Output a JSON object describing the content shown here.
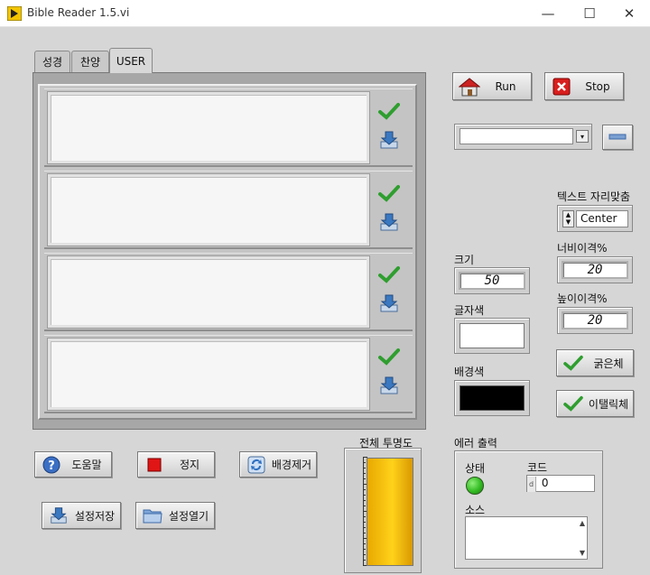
{
  "window": {
    "title": "Bible Reader 1.5.vi",
    "minimize": "—",
    "maximize": "☐",
    "close": "✕"
  },
  "tabs": [
    {
      "label": "성경"
    },
    {
      "label": "찬양"
    },
    {
      "label": "USER"
    }
  ],
  "toolbar": {
    "run_label": "Run",
    "stop_label": "Stop"
  },
  "select": {
    "value": ""
  },
  "alignment": {
    "label": "텍스트 자리맞춤",
    "value": "Center"
  },
  "width_spacing": {
    "label": "너비이격%",
    "value": "20"
  },
  "height_spacing": {
    "label": "높이이격%",
    "value": "20"
  },
  "size": {
    "label": "크기",
    "value": "50"
  },
  "font_color": {
    "label": "글자색",
    "color": "#ffffff"
  },
  "bg_color": {
    "label": "배경색",
    "color": "#000000"
  },
  "bold_button": {
    "label": "굵은체"
  },
  "italic_button": {
    "label": "이탤릭체"
  },
  "bottom_buttons": {
    "help": "도움말",
    "stop": "정지",
    "remove_bg": "배경제거",
    "save_settings": "설정저장",
    "open_settings": "설정열기"
  },
  "opacity": {
    "label": "전체 투명도",
    "level": 1.0
  },
  "error_out": {
    "title": "에러 출력",
    "status_label": "상태",
    "code_label": "코드",
    "code_prefix": "d",
    "code_value": "0",
    "source_label": "소스",
    "status_color": "#33bb22"
  },
  "colors": {
    "accent_gold": "#f0b800",
    "check_green": "#2f9e2f"
  }
}
